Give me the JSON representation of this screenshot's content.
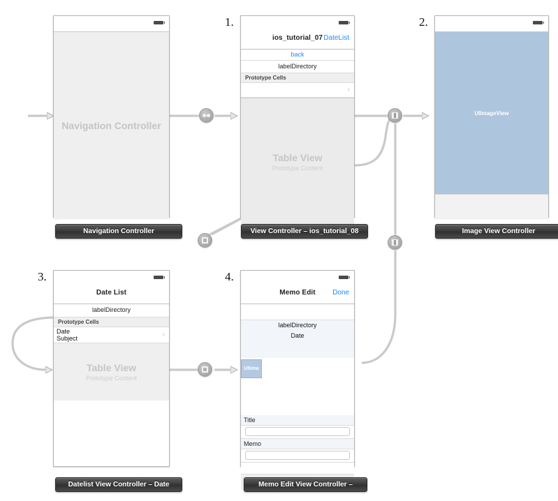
{
  "canvas": {
    "background": "#ffffff",
    "wire_color": "#bfbfbf",
    "accent_blue": "#1a8cff",
    "placeholder_gray": "#ebebeb",
    "image_blue": "#aec5de"
  },
  "scenes": [
    {
      "number": "",
      "plaque": "Navigation Controller",
      "body_label": "Navigation Controller",
      "kind": "navigation-controller"
    },
    {
      "number": "1.",
      "plaque": "View Controller – ios_tutorial_08",
      "nav_title": "ios_tutorial_07",
      "nav_right": "DateList",
      "rows": [
        {
          "text": "back",
          "style": "link"
        },
        {
          "text": "labelDirectory",
          "style": "center"
        }
      ],
      "section_header": "Prototype Cells",
      "cell_accessory": "chevron-right-icon",
      "table_title": "Table View",
      "table_subtitle": "Prototype Content"
    },
    {
      "number": "2.",
      "plaque": "Image View Controller",
      "image_label": "UIImageView",
      "kind": "image-view-controller"
    },
    {
      "number": "3.",
      "plaque": "Datelist View Controller – Date",
      "nav_title": "Date List",
      "rows": [
        {
          "text": "labelDirectory",
          "style": "center"
        }
      ],
      "section_header": "Prototype Cells",
      "cell_line_1": "Date",
      "cell_line_2": "Subject",
      "cell_accessory": "chevron-right-icon",
      "table_title": "Table View",
      "table_subtitle": "Prototype Content"
    },
    {
      "number": "4.",
      "plaque": "Memo Edit View Controller –",
      "nav_title": "Memo Edit",
      "nav_right": "Done",
      "field_directory": "labelDirectory",
      "field_date": "Date",
      "image_placeholder": "Ultima",
      "label_title": "Title",
      "label_memo": "Memo",
      "input_title_value": "",
      "input_memo_value": ""
    }
  ],
  "connectors": [
    {
      "id": "nav-root",
      "type": "relationship",
      "icon": "relationship-icon"
    },
    {
      "id": "vc07-to-image",
      "type": "push",
      "icon": "push-segue-icon"
    },
    {
      "id": "vc07-to-datelist",
      "type": "push",
      "icon": "push-segue-icon"
    },
    {
      "id": "memo-to-image",
      "type": "push",
      "icon": "push-segue-icon"
    },
    {
      "id": "datelist-to-memo",
      "type": "push",
      "icon": "push-segue-icon"
    }
  ]
}
